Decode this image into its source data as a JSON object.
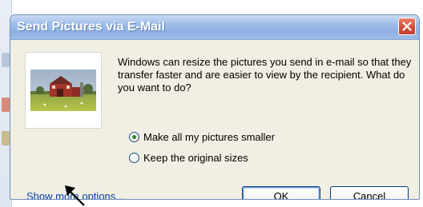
{
  "dialog": {
    "title": "Send Pictures via E-Mail",
    "close_icon": "close-icon",
    "message": "Windows can resize the pictures you send in e-mail so that they transfer faster and are easier to view by the recipient.  What do you want to do?",
    "thumbnail_icon": "picture-thumbnail-red-barn",
    "options": [
      {
        "label": "Make all my pictures smaller",
        "checked": true
      },
      {
        "label": "Keep the original sizes",
        "checked": false
      }
    ],
    "more_options_link": "Show more options...",
    "ok_label": "OK",
    "cancel_label": "Cancel"
  },
  "annotation": {
    "arrow_icon": "pointer-arrow-icon"
  },
  "colors": {
    "titlebar": "#9fbde8",
    "close_button": "#d2503a",
    "link": "#0b3fa8",
    "dialog_body": "#f1efe4"
  }
}
